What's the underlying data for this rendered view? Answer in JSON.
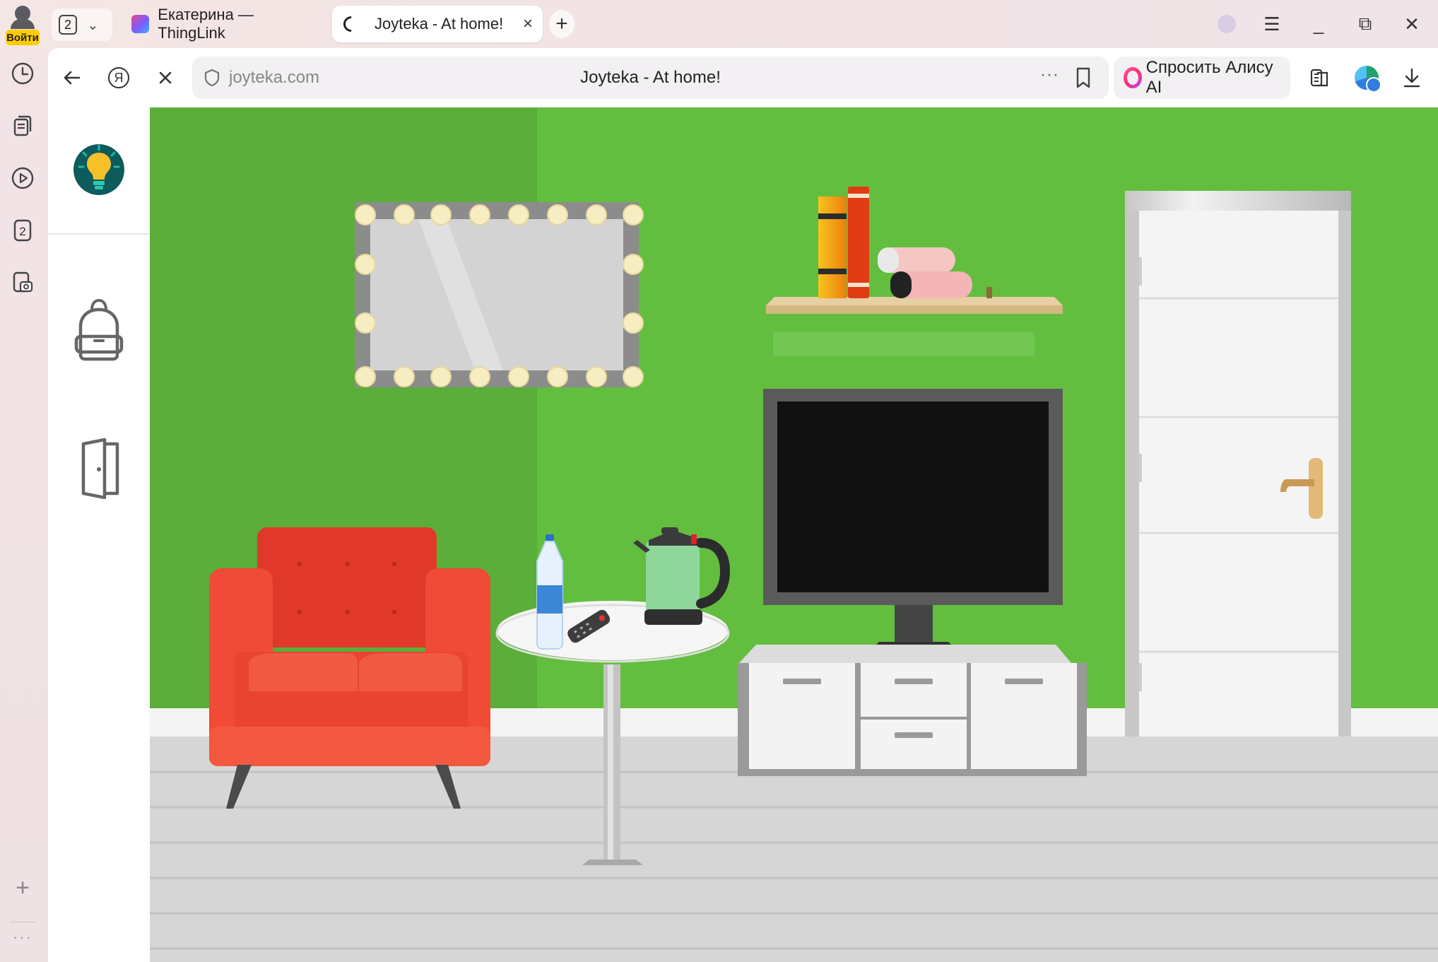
{
  "browser": {
    "profile": {
      "login_label": "Войти"
    },
    "tab_counter": "2",
    "tabs": [
      {
        "title": "Екатерина — ThingLink"
      },
      {
        "title": "Joyteka - At home!"
      }
    ],
    "sidebar_badge": "2",
    "address_bar": {
      "url": "joyteka.com",
      "page_title": "Joyteka - At home!",
      "more_label": "···"
    },
    "alisa_button": "Спросить Алису AI",
    "window_controls": {
      "menu": "☰",
      "minimize": "_",
      "restore": "⧉",
      "close": "✕"
    },
    "sidebar_add": "+",
    "sidebar_more": "···"
  },
  "game": {
    "sidebar": [
      "lightbulb-icon",
      "backpack-icon",
      "door-exit-icon"
    ],
    "scene_objects": [
      "hollywood-mirror",
      "bookshelf",
      "books",
      "tv",
      "tv-stand",
      "door",
      "armchair",
      "side-table",
      "water-bottle",
      "remote-control",
      "kettle"
    ],
    "colors": {
      "wall": "#63be3f",
      "wall_shade": "#5aae39",
      "floor": "#d6d6d6",
      "armchair": "#e8402e",
      "tv_frame": "#5b5b5b"
    }
  }
}
